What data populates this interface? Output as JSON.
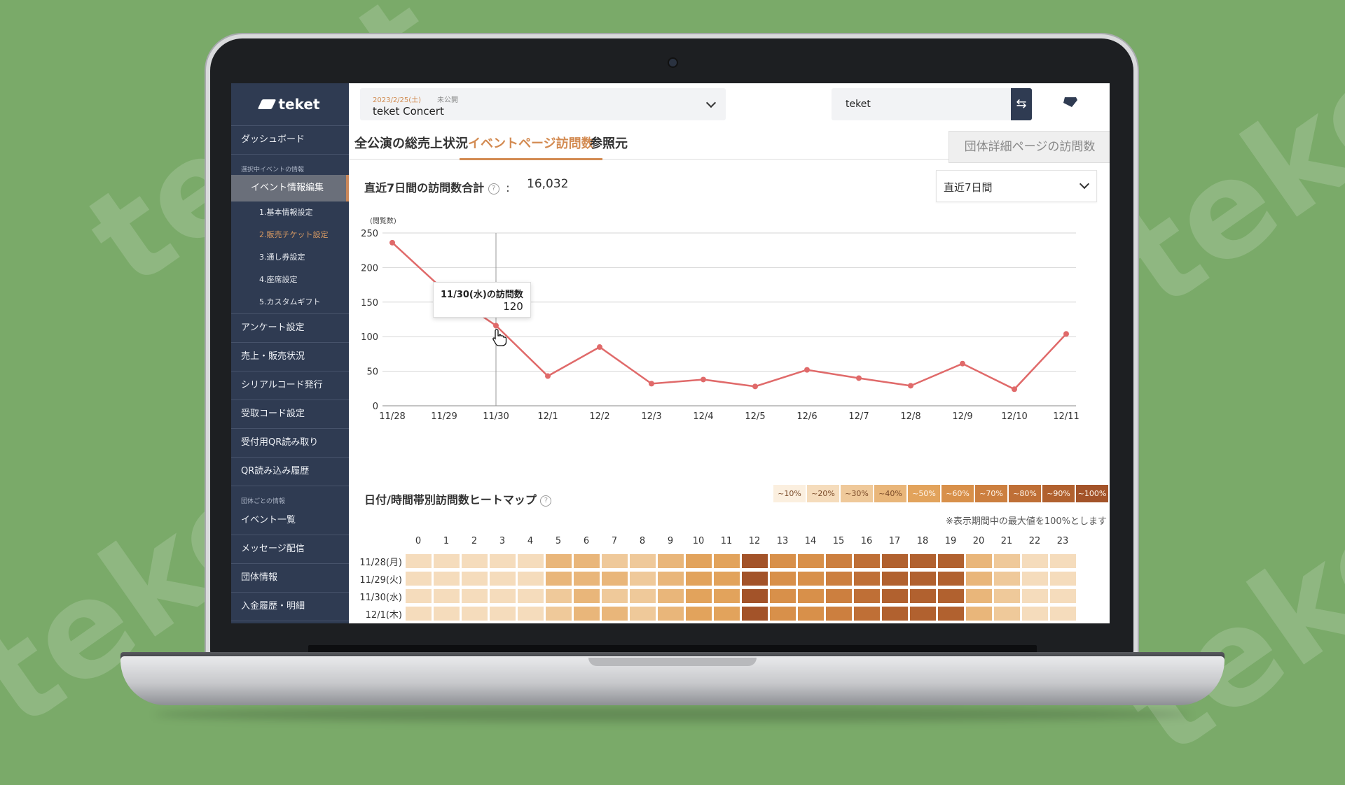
{
  "background_watermark": "teket",
  "sidebar": {
    "brand": "teket",
    "dashboard": "ダッシュボード",
    "section_current_event": "選択中イベントの情報",
    "event_edit": "イベント情報編集",
    "sub_items": [
      "1.基本情報設定",
      "2.販売チケット設定",
      "3.通し券設定",
      "4.座席設定",
      "5.カスタムギフト"
    ],
    "items_after": [
      "アンケート設定",
      "売上・販売状況",
      "シリアルコード発行",
      "受取コード設定",
      "受付用QR読み取り",
      "QR読み込み履歴"
    ],
    "section_org": "団体ごとの情報",
    "org_items": [
      "イベント一覧",
      "メッセージ配信",
      "団体情報",
      "入金履歴・明細"
    ]
  },
  "topbar": {
    "event_date": "2023/2/25(土)",
    "event_status": "未公開",
    "event_name": "teket Concert",
    "org_name": "teket",
    "swap_icon": "swap-icon",
    "ticket_icon": "ticket-icon"
  },
  "tabs": [
    "全公演の総売上状況",
    "イベントページ訪問数",
    "参照元"
  ],
  "active_tab": 1,
  "tab_right": "団体詳細ページの訪問数",
  "visits": {
    "title": "直近7日間の訪問数合計",
    "separator": ":",
    "total": "16,032",
    "range_label": "直近7日間",
    "y_unit": "(閲覧数)",
    "tooltip_title": "11/30(水)の訪問数",
    "tooltip_value": "120"
  },
  "chart_data": {
    "type": "line",
    "x": [
      "11/28",
      "11/29",
      "11/30",
      "12/1",
      "12/2",
      "12/3",
      "12/4",
      "12/5",
      "12/6",
      "12/7",
      "12/8",
      "12/9",
      "12/10",
      "12/11"
    ],
    "values": [
      236,
      167,
      116,
      43,
      85,
      32,
      38,
      28,
      52,
      40,
      29,
      61,
      24,
      104
    ],
    "ylabel": "(閲覧数)",
    "ylim": [
      0,
      250
    ],
    "yticks": [
      0,
      50,
      100,
      150,
      200,
      250
    ],
    "grid": true,
    "color": "#e06a6a",
    "highlight_x": "11/30"
  },
  "heatmap": {
    "title": "日付/時間帯別訪問数ヒートマップ",
    "legend": [
      "~10%",
      "~20%",
      "~30%",
      "~40%",
      "~50%",
      "~60%",
      "~70%",
      "~80%",
      "~90%",
      "~100%"
    ],
    "legend_colors": [
      "#fbefdf",
      "#f5dcbc",
      "#efc99a",
      "#e9b67a",
      "#e2a35c",
      "#d8904a",
      "#cc7f3f",
      "#bf6f36",
      "#b1612f",
      "#a35329"
    ],
    "note": "※表示期間中の最大値を100%とします",
    "hours": [
      "0",
      "1",
      "2",
      "3",
      "4",
      "5",
      "6",
      "7",
      "8",
      "9",
      "10",
      "11",
      "12",
      "13",
      "14",
      "15",
      "16",
      "17",
      "18",
      "19",
      "20",
      "21",
      "22",
      "23"
    ],
    "dates": [
      "11/28(月)",
      "11/29(火)",
      "11/30(水)",
      "12/1(木)"
    ],
    "levels": [
      [
        1,
        1,
        1,
        1,
        1,
        3,
        3,
        2,
        2,
        3,
        4,
        4,
        9,
        5,
        5,
        6,
        7,
        8,
        8,
        8,
        3,
        2,
        1,
        1
      ],
      [
        1,
        1,
        1,
        1,
        1,
        3,
        3,
        3,
        2,
        3,
        4,
        4,
        9,
        5,
        5,
        6,
        7,
        8,
        8,
        8,
        3,
        2,
        1,
        1
      ],
      [
        1,
        1,
        1,
        1,
        1,
        2,
        3,
        2,
        2,
        3,
        4,
        4,
        9,
        5,
        5,
        6,
        7,
        8,
        8,
        8,
        3,
        2,
        1,
        1
      ],
      [
        1,
        1,
        1,
        1,
        1,
        2,
        3,
        3,
        2,
        3,
        4,
        4,
        9,
        5,
        5,
        6,
        7,
        8,
        8,
        8,
        3,
        2,
        1,
        1
      ]
    ]
  }
}
